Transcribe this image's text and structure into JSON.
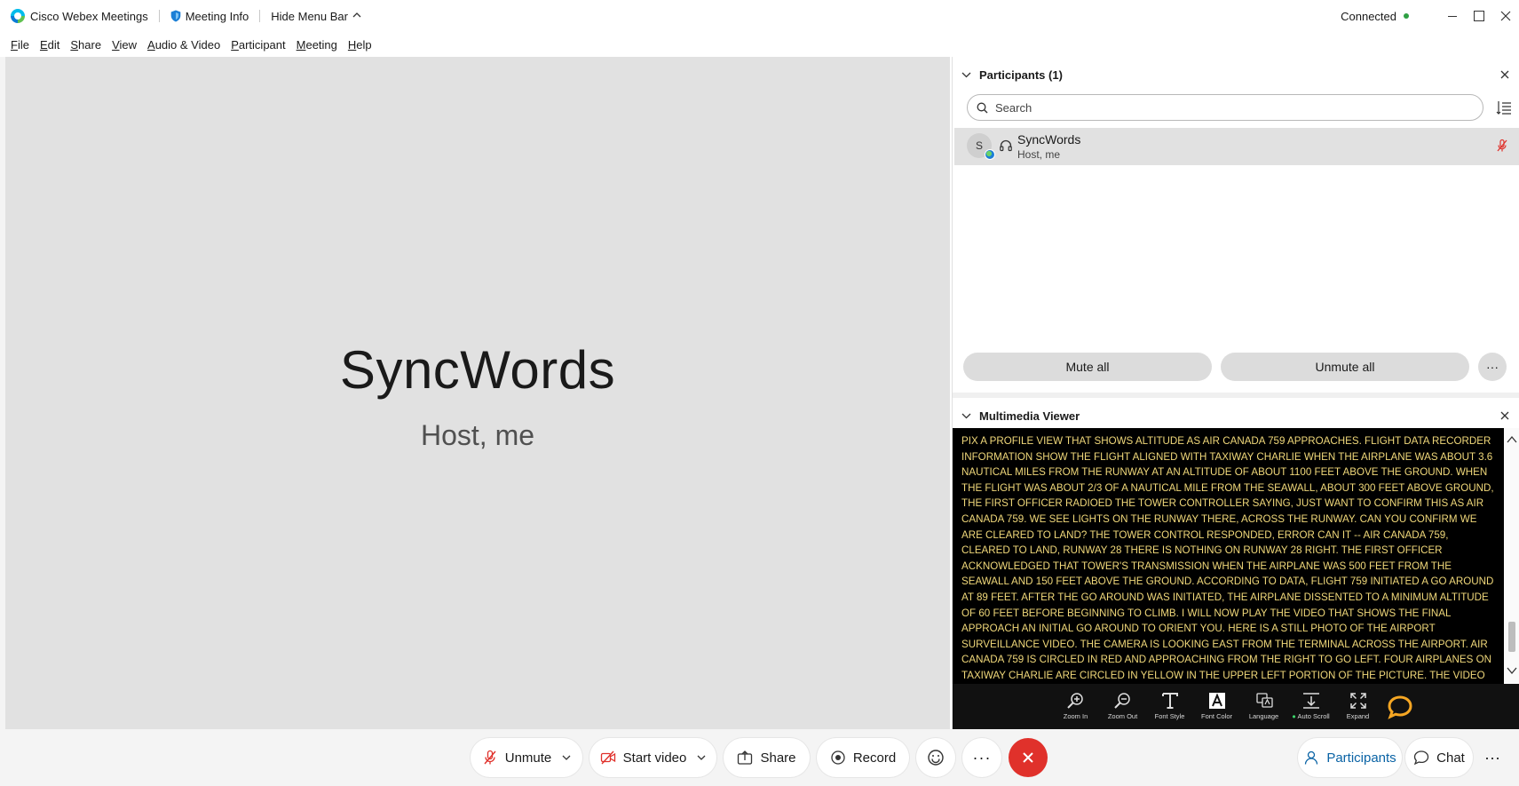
{
  "titlebar": {
    "app_name": "Cisco Webex Meetings",
    "meeting_info": "Meeting Info",
    "hide_menu": "Hide Menu Bar",
    "status": "Connected",
    "status_color": "#2ea043"
  },
  "menubar": {
    "items": [
      {
        "mnemonic": "F",
        "rest": "ile"
      },
      {
        "mnemonic": "E",
        "rest": "dit"
      },
      {
        "mnemonic": "S",
        "rest": "hare"
      },
      {
        "mnemonic": "V",
        "rest": "iew"
      },
      {
        "mnemonic": "A",
        "rest": "udio & Video"
      },
      {
        "mnemonic": "P",
        "rest": "articipant"
      },
      {
        "mnemonic": "M",
        "rest": "eeting"
      },
      {
        "mnemonic": "H",
        "rest": "elp"
      }
    ]
  },
  "stage": {
    "name": "SyncWords",
    "role": "Host, me"
  },
  "participants_panel": {
    "title": "Participants (1)",
    "search_placeholder": "Search",
    "participant": {
      "initial": "S",
      "name": "SyncWords",
      "role": "Host, me"
    },
    "mute_all": "Mute all",
    "unmute_all": "Unmute all",
    "more": "···"
  },
  "multimedia_viewer": {
    "title": "Multimedia Viewer",
    "caption_text": "PIX A PROFILE VIEW THAT SHOWS ALTITUDE AS AIR CANADA 759 APPROACHES. FLIGHT DATA RECORDER INFORMATION SHOW THE FLIGHT ALIGNED WITH TAXIWAY CHARLIE WHEN THE AIRPLANE WAS ABOUT 3.6 NAUTICAL MILES FROM THE RUNWAY AT AN ALTITUDE OF ABOUT 1100 FEET ABOVE THE GROUND. WHEN THE FLIGHT WAS ABOUT 2/3 OF A NAUTICAL MILE FROM THE SEAWALL, ABOUT 300 FEET ABOVE GROUND, THE FIRST OFFICER RADIOED THE TOWER CONTROLLER SAYING, JUST WANT TO CONFIRM THIS AS AIR CANADA 759. WE SEE LIGHTS ON THE RUNWAY THERE, ACROSS THE RUNWAY. CAN YOU CONFIRM WE ARE CLEARED TO LAND? THE TOWER CONTROL RESPONDED, ERROR CAN IT -- AIR CANADA 759, CLEARED TO LAND, RUNWAY 28 THERE IS NOTHING ON RUNWAY 28 RIGHT. THE FIRST OFFICER ACKNOWLEDGED THAT TOWER'S TRANSMISSION WHEN THE AIRPLANE WAS 500 FEET FROM THE SEAWALL AND 150 FEET ABOVE THE GROUND. ACCORDING TO DATA, FLIGHT 759 INITIATED A GO AROUND AT 89 FEET. AFTER THE GO AROUND WAS INITIATED, THE AIRPLANE DISSENTED TO A MINIMUM ALTITUDE OF 60 FEET BEFORE BEGINNING TO CLIMB. I WILL NOW PLAY THE VIDEO THAT SHOWS THE FINAL APPROACH AN INITIAL GO AROUND TO ORIENT YOU. HERE IS A STILL PHOTO OF THE AIRPORT SURVEILLANCE VIDEO. THE CAMERA IS LOOKING EAST FROM THE TERMINAL ACROSS THE AIRPORT. AIR CANADA 759 IS CIRCLED IN RED AND APPROACHING FROM THE RIGHT TO GO LEFT. FOUR AIRPLANES ON TAXIWAY CHARLIE ARE CIRCLED IN YELLOW IN THE UPPER LEFT PORTION OF THE PICTURE. THE VIDEO WILL PLAY TWICE.",
    "caption_color": "#f0d87a",
    "tools": {
      "zoom_in": "Zoom In",
      "zoom_out": "Zoom Out",
      "font_style": "Font Style",
      "font_color": "Font Color",
      "language": "Language",
      "auto_scroll": "Auto Scroll",
      "expand": "Expand"
    },
    "bubble_color": "#f5a623"
  },
  "controls": {
    "unmute": "Unmute",
    "start_video": "Start video",
    "share": "Share",
    "record": "Record",
    "more": "···",
    "participants": "Participants",
    "chat": "Chat",
    "more2": "···",
    "end_color": "#e0312b",
    "mic_muted_color": "#e0312b"
  }
}
